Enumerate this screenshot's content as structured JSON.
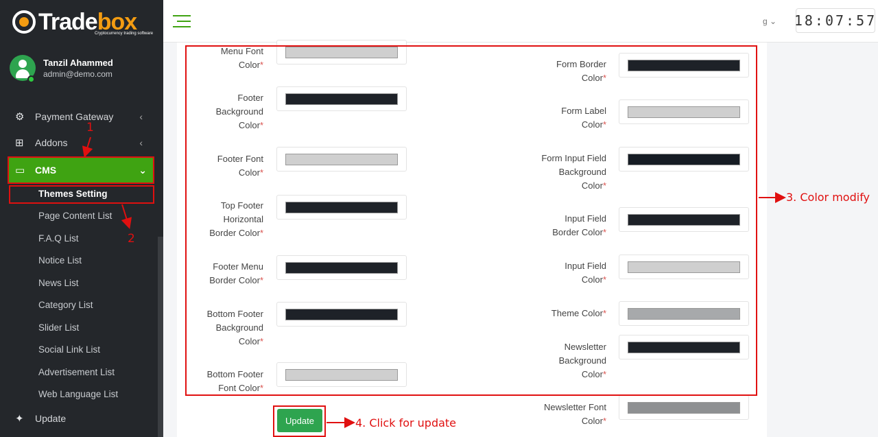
{
  "brand": {
    "name_left": "Trade",
    "name_x": "box",
    "tagline": "Cryptocurrency trading software"
  },
  "user": {
    "name": "Tanzil Ahammed",
    "email": "admin@demo.com"
  },
  "nav": {
    "payment_gateway": "Payment Gateway",
    "addons": "Addons",
    "cms": "CMS",
    "update": "Update",
    "cms_items": [
      "Themes Setting",
      "Page Content List",
      "F.A.Q List",
      "Notice List",
      "News List",
      "Category List",
      "Slider List",
      "Social Link List",
      "Advertisement List",
      "Web Language List"
    ]
  },
  "topbar": {
    "lang": "g",
    "clock": "18:07:57"
  },
  "form": {
    "left": [
      {
        "label": "Menu Font Color",
        "color": "#cfcfcf"
      },
      {
        "label": "Footer Background Color",
        "color": "#1e2228"
      },
      {
        "label": "Footer Font Color",
        "color": "#cfcfcf"
      },
      {
        "label": "Top Footer Horizontal Border Color",
        "color": "#1e2228"
      },
      {
        "label": "Footer Menu Border Color",
        "color": "#1e2228"
      },
      {
        "label": "Bottom Footer Background Color",
        "color": "#1e2228"
      },
      {
        "label": "Bottom Footer Font Color",
        "color": "#cfcfcf"
      }
    ],
    "right": [
      {
        "label": "Form Border Color",
        "color": "#1e2228"
      },
      {
        "label": "Form Label Color",
        "color": "#cfcfcf"
      },
      {
        "label": "Form Input Field Background Color",
        "color": "#161c24"
      },
      {
        "label": "Input Field Border Color",
        "color": "#1e2228"
      },
      {
        "label": "Input Field Color",
        "color": "#cfcfcf"
      },
      {
        "label": "Theme Color",
        "color": "#a7a9ab"
      },
      {
        "label": "Newsletter Background Color",
        "color": "#1e2228"
      },
      {
        "label": "Newsletter Font Color",
        "color": "#8e9092"
      }
    ],
    "required_mark": "*",
    "update_label": "Update"
  },
  "annotations": {
    "n1": "1",
    "n2": "2",
    "n3": "3. Color modify",
    "n4": "4. Click for update"
  },
  "colors": {
    "accent": "#3fa312",
    "annotation": "#e01010",
    "sidebar": "#24272b"
  }
}
